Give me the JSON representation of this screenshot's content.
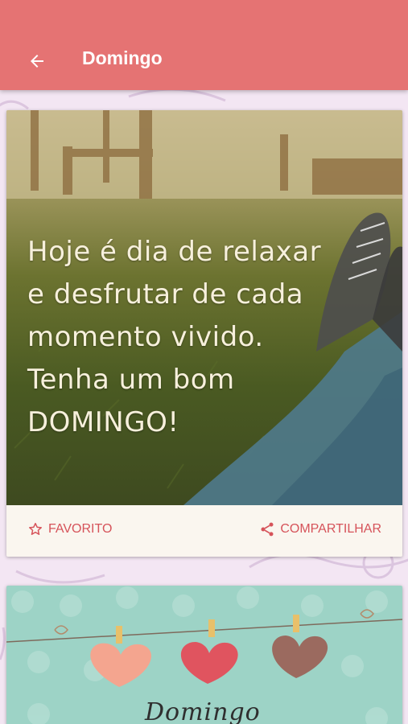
{
  "appbar": {
    "title": "Domingo",
    "background": "#e57373",
    "back_icon": "arrow-left-icon"
  },
  "cards": [
    {
      "image_text_lines": [
        "Hoje é dia de relaxar",
        "e desfrutar de cada",
        "momento vivido.",
        "Tenha um bom",
        "DOMINGO!"
      ],
      "favorite_label": "FAVORITO",
      "favorite_icon": "star-outline-icon",
      "share_label": "COMPARTILHAR",
      "share_icon": "share-icon",
      "action_color": "#d6535a"
    },
    {
      "image_text": "Domingo"
    }
  ]
}
